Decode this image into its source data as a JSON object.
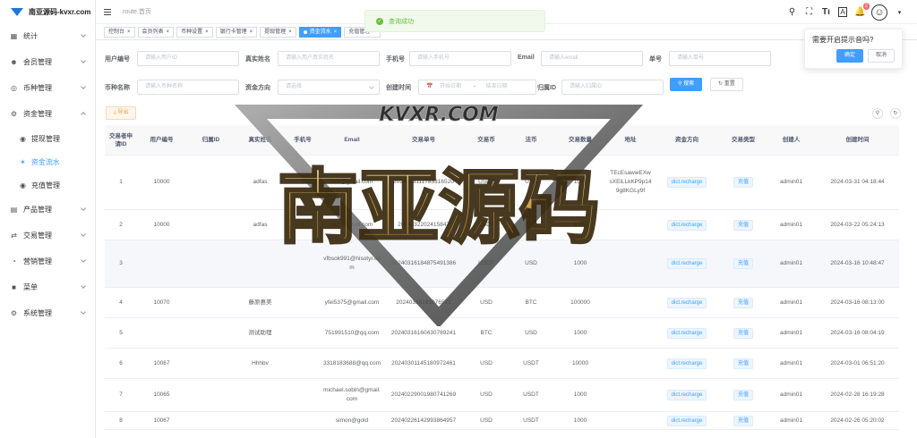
{
  "sidebar": {
    "logo": "南亚源码-kvxr.com",
    "items": [
      {
        "label": "统计",
        "icon": "dashboard-icon"
      },
      {
        "label": "会员管理",
        "icon": "users-icon"
      },
      {
        "label": "币种管理",
        "icon": "coin-icon"
      },
      {
        "label": "资金管理",
        "icon": "wallet-icon",
        "expanded": true,
        "children": [
          {
            "label": "提现管理",
            "icon": "withdraw-icon"
          },
          {
            "label": "资金流水",
            "icon": "flow-icon",
            "active": true
          },
          {
            "label": "充值管理",
            "icon": "recharge-icon"
          }
        ]
      },
      {
        "label": "产品管理",
        "icon": "product-icon"
      },
      {
        "label": "交易管理",
        "icon": "trade-icon"
      },
      {
        "label": "营销管理",
        "icon": "marketing-icon"
      },
      {
        "label": "菜单",
        "icon": "menu-icon"
      },
      {
        "label": "系统管理",
        "icon": "settings-icon"
      }
    ]
  },
  "header": {
    "breadcrumb": "route.首页",
    "notification_count": "2"
  },
  "tags": [
    {
      "label": "控制台"
    },
    {
      "label": "会员列表"
    },
    {
      "label": "币种设置"
    },
    {
      "label": "银行卡管理"
    },
    {
      "label": "提现管理"
    },
    {
      "label": "资金流水",
      "active": true
    },
    {
      "label": "充值管理"
    }
  ],
  "toast": {
    "message": "查询成功",
    "color": "#67c23a"
  },
  "popover": {
    "title": "需要开启提示音吗?",
    "confirm": "确定",
    "cancel": "取消"
  },
  "filters": {
    "user_no": {
      "label": "用户编号",
      "placeholder": "请输入用户ID"
    },
    "real_name": {
      "label": "真实姓名",
      "placeholder": "请输入用户真实姓名"
    },
    "phone": {
      "label": "手机号",
      "placeholder": "请输入手机号"
    },
    "email": {
      "label": "Email",
      "placeholder": "请输入email"
    },
    "order_no": {
      "label": "单号",
      "placeholder": "请输入单号"
    },
    "currency": {
      "label": "币种名称",
      "placeholder": "请输入币种名称"
    },
    "direction": {
      "label": "资金方向",
      "placeholder": "请选择"
    },
    "created": {
      "label": "创建时间",
      "start": "开始日期",
      "sep": "-",
      "end": "结束日期"
    },
    "belong_id": {
      "label": "归属ID",
      "placeholder": "请输入归属ID"
    },
    "search": "搜索",
    "reset": "重置",
    "export": "导出"
  },
  "table": {
    "columns": [
      "交易者申请ID",
      "用户编号",
      "归属ID",
      "真实姓名",
      "手机号",
      "Email",
      "交易单号",
      "交易币",
      "法币",
      "交易数量",
      "地址",
      "资金方向",
      "交易类型",
      "创建人",
      "创建时间"
    ],
    "rows": [
      {
        "id": "1",
        "user": "10000",
        "belong": "",
        "name": "adfas",
        "phone": "1",
        "email": "test@gmail.com",
        "order": "2024033111783316520",
        "coin": "USDT",
        "fiat": "USD",
        "amount": "1000",
        "address": "TEcEsawwEXwsXEiLLkKP9p149g8KGLy9f",
        "direction": "dict.recharge",
        "type": "充值",
        "creator": "admin01",
        "time": "2024-03-31 04:18:44"
      },
      {
        "id": "2",
        "user": "10000",
        "belong": "",
        "name": "adfas",
        "phone": "1",
        "email": "test@gmail.com",
        "order": "2024032202415847",
        "coin": "USDT",
        "fiat": "USD",
        "amount": "1000",
        "address": "",
        "direction": "dict.recharge",
        "type": "充值",
        "creator": "admin01",
        "time": "2024-03-22 05:24:13"
      },
      {
        "id": "3",
        "user": "",
        "belong": "",
        "name": "",
        "phone": "",
        "email": "vfbsok991@hisotyr.com",
        "order": "20240316184875491386",
        "coin": "USDT",
        "fiat": "USD",
        "amount": "1000",
        "address": "",
        "direction": "dict.recharge",
        "type": "充值",
        "creator": "admin01",
        "time": "2024-03-16 10:48:47",
        "highlight": true
      },
      {
        "id": "4",
        "user": "10070",
        "belong": "",
        "name": "藤原惠美",
        "phone": "",
        "email": "yfei5375@gmail.com",
        "order": "20240316181076571",
        "coin": "USD",
        "fiat": "BTC",
        "amount": "100000",
        "address": "",
        "direction": "dict.recharge",
        "type": "充值",
        "creator": "admin01",
        "time": "2024-03-16 08:13:00"
      },
      {
        "id": "5",
        "user": "",
        "belong": "",
        "name": "测试助理",
        "phone": "",
        "email": "751991510@qq.com",
        "order": "20240316160430789241",
        "coin": "BTC",
        "fiat": "USD",
        "amount": "1000",
        "address": "",
        "direction": "dict.recharge",
        "type": "充值",
        "creator": "admin01",
        "time": "2024-03-16 08:04:19"
      },
      {
        "id": "6",
        "user": "10067",
        "belong": "",
        "name": "Hhhbv",
        "phone": "",
        "email": "3318183688@qq.com",
        "order": "20240301145180972461",
        "coin": "USD",
        "fiat": "USDT",
        "amount": "10000",
        "address": "",
        "direction": "dict.recharge",
        "type": "充值",
        "creator": "admin01",
        "time": "2024-03-01 06:51:20"
      },
      {
        "id": "7",
        "user": "10065",
        "belong": "",
        "name": "",
        "phone": "",
        "email": "michael.sobin@gmail.com",
        "order": "20240229001980741269",
        "coin": "USD",
        "fiat": "USDT",
        "amount": "1000",
        "address": "",
        "direction": "dict.recharge",
        "type": "充值",
        "creator": "admin01",
        "time": "2024-02-28 16:19:28"
      },
      {
        "id": "8",
        "user": "10067",
        "belong": "",
        "name": "",
        "phone": "",
        "email": "simon@gold",
        "order": "20240226142993864957",
        "coin": "USD",
        "fiat": "USDT",
        "amount": "1000",
        "address": "",
        "direction": "dict.recharge",
        "type": "充值",
        "creator": "admin01",
        "time": "2024-02-26 05:20:02"
      }
    ]
  },
  "watermark": {
    "domain": "KVXR.COM",
    "text": "南亚源码"
  },
  "colors": {
    "primary": "#409eff",
    "success": "#67c23a",
    "warning": "#e6a23c"
  }
}
